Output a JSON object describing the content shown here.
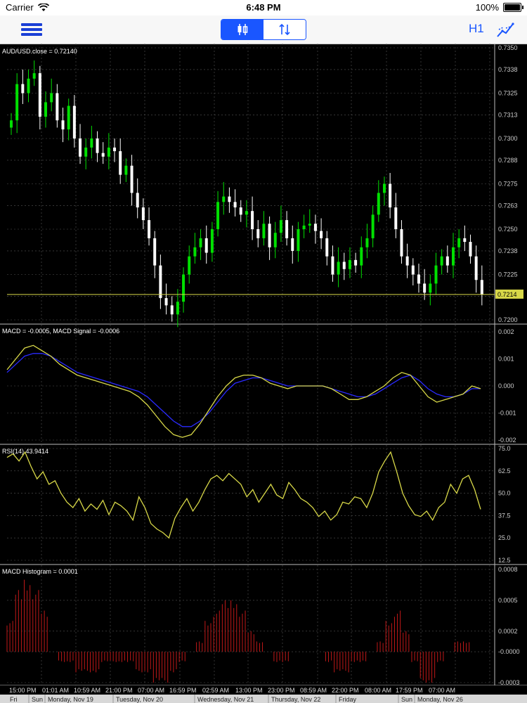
{
  "status": {
    "carrier": "Carrier",
    "time": "6:48 PM",
    "battery": "100%"
  },
  "toolbar": {
    "timeframe": "H1",
    "menu_icon": "hamburger-menu-icon",
    "candle_icon": "candlestick-icon",
    "sort_icon": "sort-arrows-icon",
    "indicator_icon": "indicator-icon"
  },
  "colors": {
    "bull": "#00e000",
    "bear": "#ffffff",
    "signal": "#2a2aff",
    "line": "#d8d848",
    "hist": "#c01818",
    "accent": "#1a56ff"
  },
  "price": {
    "label": "AUD/USD.close = 0.72140",
    "levels": [
      "0.7350",
      "0.7338",
      "0.7325",
      "0.7313",
      "0.7300",
      "0.7288",
      "0.7275",
      "0.7263",
      "0.7250",
      "0.7238",
      "0.7225",
      "0.7213",
      "0.7200"
    ],
    "tag": "0.7214",
    "close": 0.7214,
    "min": 0.72,
    "max": 0.735,
    "closes": [
      0.731,
      0.733,
      0.7325,
      0.7333,
      0.7336,
      0.7312,
      0.732,
      0.7325,
      0.731,
      0.7305,
      0.7318,
      0.73,
      0.729,
      0.7295,
      0.73,
      0.7292,
      0.729,
      0.7295,
      0.7293,
      0.728,
      0.7285,
      0.727,
      0.7262,
      0.7255,
      0.7245,
      0.723,
      0.7212,
      0.7208,
      0.7203,
      0.721,
      0.7225,
      0.7235,
      0.724,
      0.7245,
      0.7237,
      0.725,
      0.7265,
      0.7268,
      0.7265,
      0.7262,
      0.7258,
      0.726,
      0.725,
      0.7245,
      0.7253,
      0.724,
      0.7248,
      0.7255,
      0.7245,
      0.7238,
      0.725,
      0.7252,
      0.7253,
      0.7249,
      0.7245,
      0.7235,
      0.7225,
      0.7232,
      0.7228,
      0.7233,
      0.723,
      0.724,
      0.7245,
      0.7258,
      0.727,
      0.7275,
      0.7262,
      0.725,
      0.7235,
      0.723,
      0.7225,
      0.722,
      0.7215,
      0.722,
      0.723,
      0.7235,
      0.723,
      0.724,
      0.7245,
      0.7243,
      0.7235,
      0.7222,
      0.7214
    ]
  },
  "macd": {
    "label": "MACD = -0.0005, MACD Signal = -0.0006",
    "levels": [
      "0.002",
      "0.001",
      "0.000",
      "-0.001",
      "-0.002"
    ],
    "min": -0.002,
    "max": 0.002,
    "macd": [
      0.0006,
      0.001,
      0.0014,
      0.0015,
      0.0013,
      0.0011,
      0.0008,
      0.0006,
      0.0004,
      0.0003,
      0.0002,
      0.0001,
      0.0,
      -0.0001,
      -0.0002,
      -0.0004,
      -0.0007,
      -0.0011,
      -0.0015,
      -0.0018,
      -0.0019,
      -0.0018,
      -0.0014,
      -0.0009,
      -0.0004,
      0.0,
      0.0003,
      0.0004,
      0.0004,
      0.0003,
      0.0001,
      0.0,
      -0.0001,
      0.0,
      0.0,
      0.0,
      0.0,
      -0.0001,
      -0.0003,
      -0.0005,
      -0.0005,
      -0.0004,
      -0.0002,
      0.0,
      0.0003,
      0.0005,
      0.0004,
      0.0,
      -0.0004,
      -0.0006,
      -0.0005,
      -0.0004,
      -0.0003,
      0.0,
      -0.0001
    ],
    "signal": [
      0.0005,
      0.0008,
      0.0011,
      0.0012,
      0.0012,
      0.0011,
      0.0009,
      0.0007,
      0.0005,
      0.0004,
      0.0003,
      0.0002,
      0.0001,
      0.0,
      -0.0001,
      -0.0002,
      -0.0004,
      -0.0007,
      -0.001,
      -0.0013,
      -0.0015,
      -0.0015,
      -0.0013,
      -0.001,
      -0.0006,
      -0.0002,
      0.0001,
      0.0002,
      0.0003,
      0.0003,
      0.0002,
      0.0001,
      0.0,
      0.0,
      0.0,
      0.0,
      0.0,
      -0.0001,
      -0.0002,
      -0.0003,
      -0.0004,
      -0.0004,
      -0.0003,
      -0.0001,
      0.0001,
      0.0003,
      0.0004,
      0.0002,
      -0.0001,
      -0.0003,
      -0.0004,
      -0.0004,
      -0.0003,
      -0.0001,
      -0.0001
    ]
  },
  "rsi": {
    "label": "RSI(14) 43.9414",
    "levels": [
      "75.0",
      "62.5",
      "50.0",
      "37.5",
      "25.0",
      "12.5"
    ],
    "min": 12.5,
    "max": 75.0,
    "values": [
      70,
      72,
      68,
      73,
      65,
      58,
      62,
      55,
      57,
      50,
      45,
      42,
      47,
      40,
      44,
      41,
      46,
      38,
      45,
      43,
      40,
      35,
      48,
      42,
      33,
      30,
      28,
      25,
      36,
      42,
      47,
      40,
      45,
      52,
      58,
      60,
      57,
      61,
      58,
      55,
      48,
      52,
      45,
      50,
      55,
      49,
      47,
      56,
      52,
      47,
      45,
      42,
      37,
      40,
      35,
      38,
      45,
      44,
      48,
      47,
      42,
      50,
      62,
      68,
      73,
      62,
      50,
      43,
      38,
      37,
      40,
      35,
      42,
      45,
      55,
      50,
      58,
      60,
      52,
      41
    ],
    "close": 43.9414
  },
  "hist": {
    "label": "MACD Histogram = 0.0001",
    "levels": [
      "0.0008",
      "0.0005",
      "0.0002",
      "-0.0000",
      "-0.0003"
    ],
    "min": -0.0003,
    "max": 0.0008,
    "values": [
      0.0003,
      0.0006,
      0.0007,
      0.0006,
      0.0004,
      0.0,
      -0.0001,
      -0.0001,
      -0.0002,
      -0.0002,
      -0.0002,
      -0.0001,
      -0.0001,
      -0.0001,
      -0.0001,
      -0.0002,
      -0.0002,
      -0.0003,
      -0.0003,
      -0.0002,
      -0.0001,
      0.0,
      0.0001,
      0.0003,
      0.0004,
      0.0005,
      0.0005,
      0.0004,
      0.0002,
      0.0001,
      0.0,
      -0.0001,
      -0.0001,
      0.0,
      0.0,
      0.0,
      0.0,
      -0.0001,
      -0.0002,
      -0.0002,
      -0.0001,
      -0.0001,
      0.0,
      0.0001,
      0.0003,
      0.0004,
      0.0002,
      -0.0001,
      -0.0003,
      -0.0003,
      -0.0001,
      0.0,
      0.0001,
      0.0001,
      0.0
    ]
  },
  "time_labels": [
    "15:00 PM",
    "01:01 AM",
    "10:59 AM",
    "21:00 PM",
    "07:00 AM",
    "16:59 PM",
    "02:59 AM",
    "13:00 PM",
    "23:00 PM",
    "08:59 AM",
    "22:00 PM",
    "08:00 AM",
    "17:59 PM",
    "07:00 AM"
  ],
  "day_labels": [
    "Fri",
    "Sun",
    "Monday, Nov 19",
    "Tuesday, Nov 20",
    "Wednesday, Nov 21",
    "Thursday, Nov 22",
    "Friday",
    "Sun",
    "Monday, Nov 26"
  ]
}
